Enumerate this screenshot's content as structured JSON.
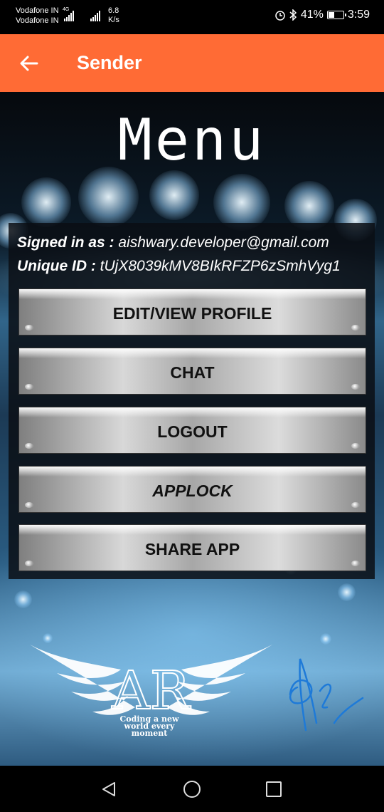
{
  "status_bar": {
    "carrier1": "Vodafone IN",
    "carrier2": "Vodafone IN",
    "network_type": "4G",
    "speed_value": "6.8",
    "speed_unit": "K/s",
    "battery_percent": "41%",
    "battery_level": 0.41,
    "time": "3:59",
    "icons": [
      "alarm-icon",
      "bluetooth-icon",
      "battery-icon"
    ]
  },
  "app_bar": {
    "title": "Sender",
    "back_icon": "arrow-left-icon",
    "color": "#ff6b35"
  },
  "menu_title": "Menu",
  "user_info": {
    "signed_in_label": "Signed in as :",
    "email": "aishwary.developer@gmail.com",
    "unique_id_label": "Unique ID :",
    "unique_id": "tUjX8039kMV8BIkRFZP6zSmhVyg1"
  },
  "buttons": {
    "edit_profile": "EDIT/VIEW PROFILE",
    "chat": "CHAT",
    "logout": "LOGOUT",
    "applock": "APPLOCK",
    "share_app": "SHARE APP"
  },
  "logo": {
    "monogram": "AR",
    "tagline_line1": "Coding a new",
    "tagline_line2": "world every",
    "tagline_line3": "moment"
  },
  "nav_bar": {
    "icons": [
      "back-triangle-icon",
      "home-circle-icon",
      "recents-square-icon"
    ]
  }
}
